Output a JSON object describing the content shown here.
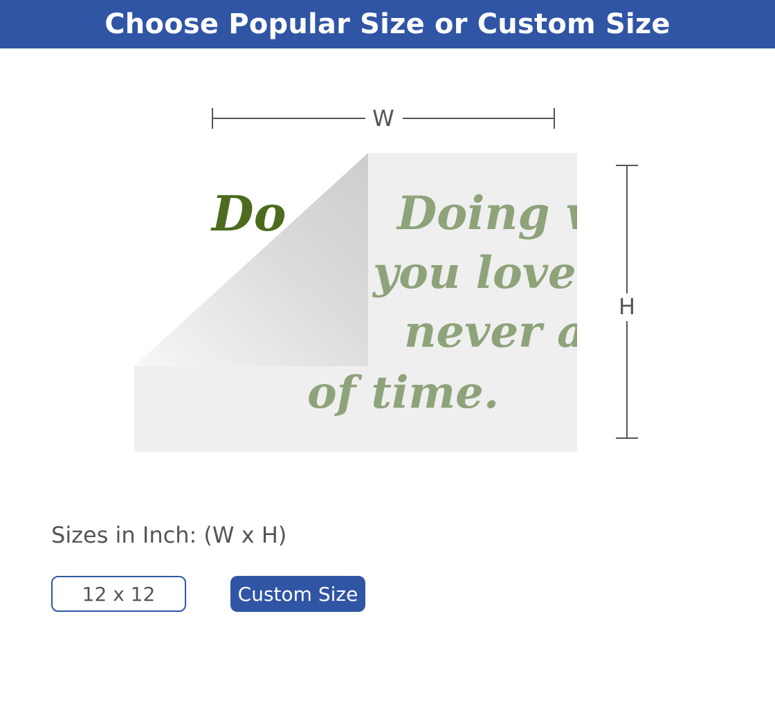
{
  "header": {
    "title": "Choose Popular Size or Custom Size"
  },
  "diagram": {
    "width_label": "W",
    "height_label": "H",
    "decal_text": [
      "Doing what",
      "you love is",
      "never a waste",
      "of time."
    ]
  },
  "sizes": {
    "label": "Sizes in Inch: (W x H)",
    "options": [
      "12 x 12"
    ],
    "custom_label": "Custom Size"
  },
  "colors": {
    "brand": "#2f55a4",
    "text_green": "#8ea37a",
    "text_dark_green": "#4d6b1e"
  }
}
